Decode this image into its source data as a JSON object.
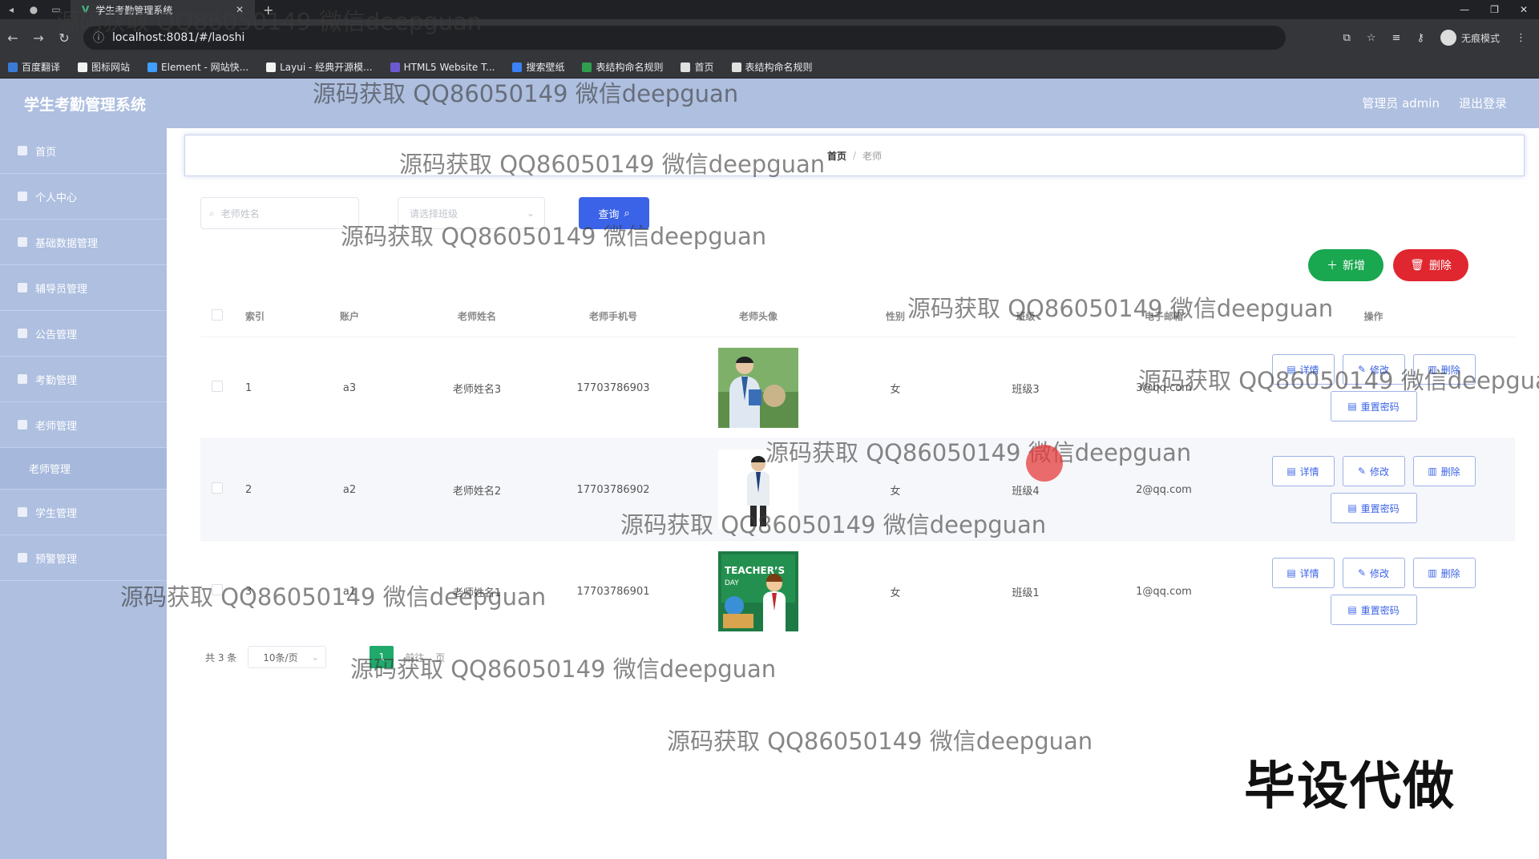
{
  "browser": {
    "tab_title": "学生考勤管理系统",
    "url": "localhost:8081/#/laoshi",
    "incognito_label": "无痕模式",
    "bookmarks": [
      {
        "label": "百度翻译",
        "color": "#3a7bd5"
      },
      {
        "label": "图标网站",
        "color": "#f2f2f2"
      },
      {
        "label": "Element - 网站快...",
        "color": "#409eff"
      },
      {
        "label": "Layui - 经典开源模...",
        "color": "#f2f2f2"
      },
      {
        "label": "HTML5 Website T...",
        "color": "#6a5acd"
      },
      {
        "label": "搜索壁纸",
        "color": "#3b82f6"
      },
      {
        "label": "表结构命名规则",
        "color": "#2e9e4f"
      },
      {
        "label": "首页",
        "color": "#e0e0e0"
      },
      {
        "label": "表结构命名规则",
        "color": "#e0e0e0"
      }
    ]
  },
  "header": {
    "title": "学生考勤管理系统",
    "user": "管理员 admin",
    "logout": "退出登录"
  },
  "sidebar": {
    "items": [
      {
        "label": "首页"
      },
      {
        "label": "个人中心"
      },
      {
        "label": "基础数据管理"
      },
      {
        "label": "辅导员管理"
      },
      {
        "label": "公告管理"
      },
      {
        "label": "考勤管理"
      },
      {
        "label": "老师管理"
      }
    ],
    "sub_item": "老师管理",
    "items_after": [
      {
        "label": "学生管理"
      },
      {
        "label": "预警管理"
      }
    ]
  },
  "breadcrumb": {
    "home": "首页",
    "separator": "/",
    "current": "老师"
  },
  "search": {
    "name_placeholder": "老师姓名",
    "class_placeholder": "请选择班级",
    "query_label": "查询"
  },
  "actions": {
    "add_label": "新增",
    "delete_label": "删除"
  },
  "table": {
    "headers": [
      "索引",
      "账户",
      "老师姓名",
      "老师手机号",
      "老师头像",
      "性别",
      "班级",
      "电子邮箱",
      "操作"
    ],
    "rows": [
      {
        "index": "1",
        "account": "a3",
        "name": "老师姓名3",
        "phone": "17703786903",
        "gender": "女",
        "class": "班级3",
        "email": "3@qq.com"
      },
      {
        "index": "2",
        "account": "a2",
        "name": "老师姓名2",
        "phone": "17703786902",
        "gender": "女",
        "class": "班级4",
        "email": "2@qq.com"
      },
      {
        "index": "3",
        "account": "a1",
        "name": "老师姓名1",
        "phone": "17703786901",
        "gender": "女",
        "class": "班级1",
        "email": "1@qq.com"
      }
    ],
    "op_labels": {
      "detail": "详情",
      "edit": "修改",
      "delete": "删除",
      "reset": "重置密码"
    }
  },
  "pagination": {
    "total": "共 3 条",
    "page_size": "10条/页",
    "current_page": "1",
    "prev": "前往",
    "page_suffix": "页"
  },
  "overlay": {
    "watermark": "源码获取 QQ86050149 微信deepguan",
    "stamp": "毕设代做"
  },
  "colors": {
    "header_bg": "#aebfe0",
    "primary": "#3b63e7",
    "success": "#19a750",
    "danger": "#e0262e",
    "pager_active": "#1faa6b"
  }
}
